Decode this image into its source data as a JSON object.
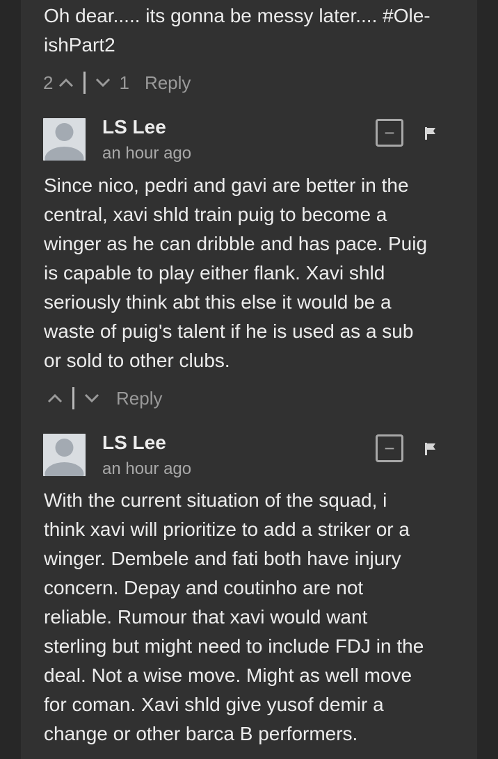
{
  "comments": [
    {
      "text": "Oh dear..... its gonna be messy later.... #Ole-\nishPart2",
      "upvotes": "2",
      "downvotes": "1",
      "reply_label": "Reply"
    },
    {
      "author": "LS Lee",
      "time": "an hour ago",
      "collapse_label": "−",
      "text": "Since nico, pedri and gavi are better in the\ncentral, xavi shld train puig to become a\nwinger as he can dribble and has pace. Puig\nis capable to play either flank. Xavi shld\nseriously think abt this else it would be a\nwaste of puig's talent if he is used as a sub\nor sold to other clubs.",
      "reply_label": "Reply"
    },
    {
      "author": "LS Lee",
      "time": "an hour ago",
      "collapse_label": "−",
      "text": "With the current situation of the squad, i\nthink xavi will prioritize to add a striker or a\nwinger. Dembele and fati both have injury\nconcern. Depay and coutinho are not\nreliable. Rumour that xavi would want\nsterling but might need to include FDJ in the\ndeal. Not a wise move. Might as well move\nfor coman. Xavi shld give yusof demir a\nchange or other barca B performers."
    }
  ],
  "icons": {
    "upvote": "chevron-up-icon",
    "downvote": "chevron-down-icon",
    "flag": "flag-icon",
    "avatar": "default-user-avatar"
  },
  "colors": {
    "background": "#272727",
    "panel": "#313131",
    "text": "#ececec",
    "muted": "#9a9a9a"
  }
}
